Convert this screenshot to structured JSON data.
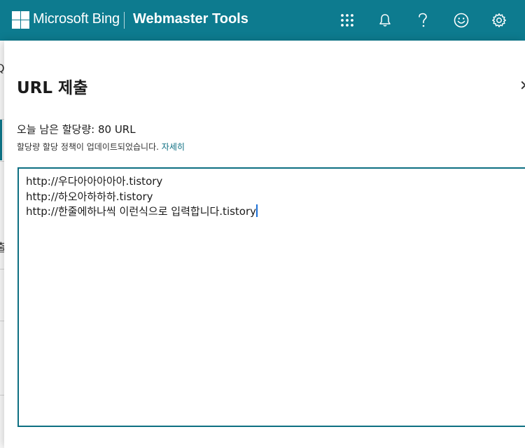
{
  "header": {
    "brand": "Microsoft Bing",
    "product": "Webmaster Tools",
    "icons": [
      "apps-grid-icon",
      "bell-icon",
      "help-icon",
      "smiley-feedback-icon",
      "gear-icon"
    ],
    "bg_color": "#0d7b8f"
  },
  "panel": {
    "title": "URL 제출",
    "quota_text": "오늘 남은 할당량: 80 URL",
    "policy_text": "할당량 할당 정책이 업데이트되었습니다.",
    "policy_link": "자세히",
    "urls": [
      "http://우다아아아아아.tistory",
      "http://하오아하하하.tistory",
      "http://한줄에하나씩 이런식으로 입력합니다.tistory"
    ],
    "accent_color": "#0d6f82"
  },
  "background": {
    "left_glyphs": [
      "Q",
      "출"
    ]
  }
}
